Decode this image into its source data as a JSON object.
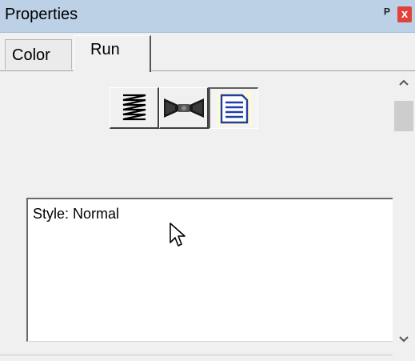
{
  "window": {
    "title": "Properties",
    "pin_icon": "pin-icon",
    "close_icon": "close-icon",
    "close_color": "#e0433a",
    "titlebar_color": "#bcd0e6"
  },
  "tabs": [
    {
      "label": "Color",
      "selected": false
    },
    {
      "label": "Run",
      "selected": true
    }
  ],
  "toolbar": {
    "buttons": [
      {
        "icon": "spring-icon",
        "pressed": false
      },
      {
        "icon": "bowtie-icon",
        "pressed": false
      },
      {
        "icon": "note-icon",
        "pressed": true
      }
    ]
  },
  "details": {
    "text": "Style: Normal"
  },
  "scrollbar": {
    "up_icon": "chevron-up-icon",
    "down_icon": "chevron-down-icon"
  }
}
